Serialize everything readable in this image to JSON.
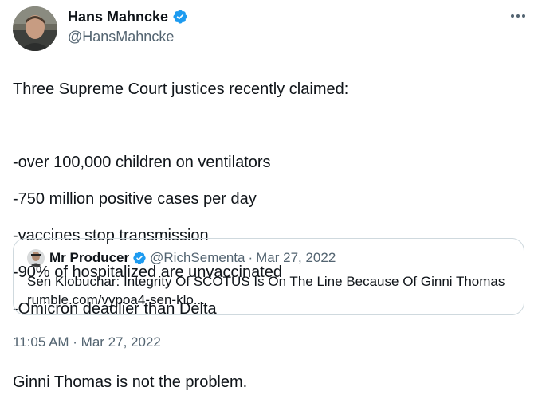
{
  "author": {
    "display_name": "Hans Mahncke",
    "handle": "@HansMahncke",
    "verified_icon": "verified-badge-icon"
  },
  "tweet": {
    "lines": [
      "Three Supreme Court justices recently claimed:",
      "",
      "-over 100,000 children on ventilators",
      "-750 million positive cases per day",
      "-vaccines stop transmission",
      "-90% of hospitalized are unvaccinated",
      "-Omicron deadlier than Delta",
      "",
      "Ginni Thomas is not the problem."
    ],
    "timestamp": "11:05 AM · Mar 27, 2022"
  },
  "quote": {
    "display_name": "Mr Producer",
    "handle": "@RichSementa",
    "separator": "·",
    "date": "Mar 27, 2022",
    "text": "Sen Klobuchar: Integrity Of SCOTUS Is On The Line Because Of Ginni Thomas",
    "link": "rumble.com/vypoa4-sen-klo..."
  },
  "icons": {
    "more": "more-horizontal-icon",
    "verified": "verified-badge-icon"
  },
  "colors": {
    "verified_blue": "#1d9bf0",
    "secondary_text": "#536471",
    "border": "#cfd9de"
  }
}
